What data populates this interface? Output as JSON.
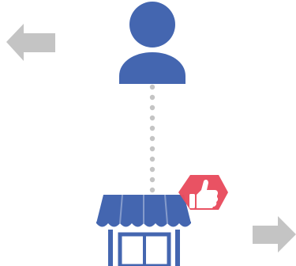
{
  "icons": [
    {
      "name": "arrow-left-icon",
      "color": "#c4c4c4"
    },
    {
      "name": "person-icon",
      "color": "#4466b0"
    },
    {
      "name": "dotted-connector",
      "color": "#c4c4c4"
    },
    {
      "name": "storefront-icon",
      "color": "#4466b0"
    },
    {
      "name": "thumbs-up-icon",
      "color": "#e84c5e",
      "glyph_color": "#ffffff"
    },
    {
      "name": "arrow-right-icon",
      "color": "#c4c4c4"
    }
  ]
}
